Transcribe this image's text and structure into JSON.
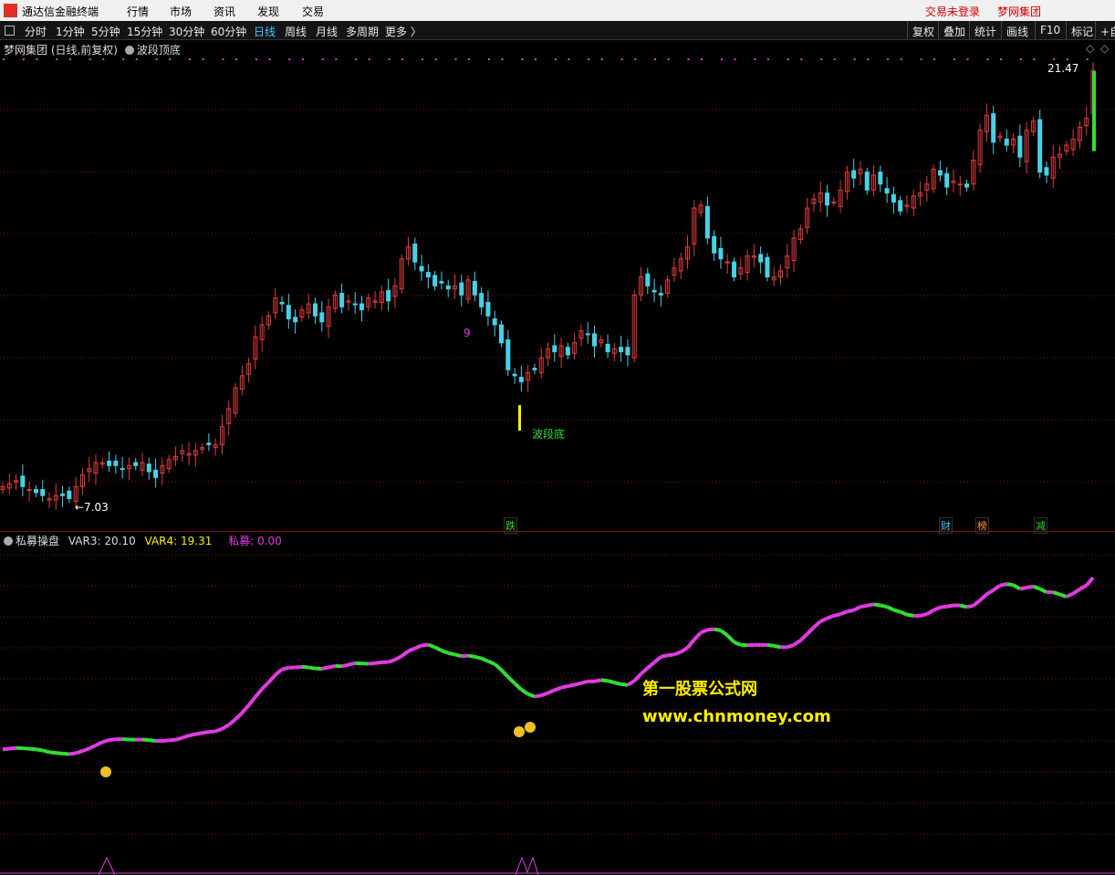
{
  "menubar": {
    "app_title": "通达信金融终端",
    "items": [
      "行情",
      "市场",
      "资讯",
      "发现",
      "交易"
    ],
    "right_items": [
      "交易未登录",
      "梦网集团"
    ]
  },
  "toolbar": {
    "periods": [
      "分时",
      "1分钟",
      "5分钟",
      "15分钟",
      "30分钟",
      "60分钟",
      "日线",
      "周线",
      "月线",
      "多周期",
      "更多 〉"
    ],
    "active_period": "日线",
    "right_buttons": [
      "复权",
      "叠加",
      "统计",
      "画线",
      "F10",
      "标记",
      "+自"
    ]
  },
  "main_panel": {
    "title": "梦网集团 (日线,前复权)",
    "indicator": "波段顶底",
    "high_label": "21.47",
    "low_label": "←7.03",
    "signal_label": "波段底",
    "minor_label": "9",
    "event_tags": [
      "跌",
      "财",
      "榜",
      "减"
    ]
  },
  "sub_panel": {
    "title": "私募操盘",
    "var3_label": "VAR3:",
    "var3_value": "20.10",
    "var4_label": "VAR4:",
    "var4_value": "19.31",
    "private_label": "私募:",
    "private_value": "0.00"
  },
  "watermark": {
    "line1": "第一股票公式网",
    "line2": "www.chnmoney.com"
  },
  "colors": {
    "up": "#e03c3c",
    "down": "#46d2e6",
    "grid": "#8a1010",
    "magenta": "#e23be2",
    "green": "#33dd33",
    "yellow": "#ffee00"
  },
  "chart_data": {
    "type": "candlestick",
    "price_range": [
      7.03,
      21.47
    ],
    "closes": [
      7.6,
      7.7,
      7.8,
      7.6,
      7.5,
      7.4,
      7.3,
      7.2,
      7.3,
      7.3,
      7.2,
      7.6,
      8.0,
      8.2,
      8.4,
      8.4,
      8.3,
      8.3,
      8.2,
      8.3,
      8.3,
      8.4,
      8.1,
      7.9,
      8.3,
      8.5,
      8.6,
      8.8,
      8.7,
      8.8,
      8.9,
      9.0,
      9.0,
      9.6,
      10.2,
      10.9,
      11.3,
      11.7,
      12.6,
      13.0,
      13.3,
      13.9,
      13.7,
      13.2,
      13.1,
      13.5,
      13.7,
      13.3,
      13.1,
      13.6,
      14.0,
      13.6,
      13.8,
      13.7,
      13.5,
      13.9,
      13.8,
      14.1,
      13.8,
      14.3,
      15.2,
      15.6,
      15.1,
      14.8,
      14.6,
      14.3,
      14.4,
      14.2,
      14.3,
      14.0,
      14.5,
      14.0,
      13.6,
      13.3,
      13.0,
      12.4,
      11.5,
      11.3,
      11.1,
      11.4,
      11.5,
      11.9,
      12.2,
      12.1,
      12.3,
      12.0,
      12.4,
      12.8,
      12.7,
      12.3,
      12.5,
      12.1,
      12.2,
      12.1,
      12.0,
      14.0,
      14.6,
      14.3,
      14.1,
      14.0,
      14.5,
      14.9,
      15.2,
      15.6,
      16.9,
      17.0,
      15.9,
      15.4,
      15.2,
      15.1,
      14.6,
      14.9,
      15.3,
      15.3,
      15.1,
      14.6,
      14.6,
      14.8,
      15.3,
      15.9,
      16.2,
      16.9,
      17.2,
      17.4,
      17.0,
      17.1,
      17.5,
      18.1,
      17.9,
      18.2,
      17.5,
      18.0,
      17.7,
      17.4,
      17.1,
      16.8,
      17.0,
      17.3,
      17.4,
      17.7,
      18.2,
      18.0,
      17.6,
      17.8,
      17.7,
      17.6,
      18.5,
      19.5,
      20.0,
      19.1,
      19.3,
      19.0,
      19.2,
      18.6,
      19.5,
      19.8,
      18.1,
      18.0,
      18.6,
      18.7,
      19.0,
      19.2,
      19.6,
      19.9,
      21.5
    ],
    "volume_magenta_dots_note": "signal markers along top of main panel",
    "sub_lines": [
      {
        "name": "VAR3",
        "value": 20.1
      },
      {
        "name": "VAR4",
        "value": 19.31
      },
      {
        "name": "私募",
        "value": 0.0
      }
    ]
  }
}
